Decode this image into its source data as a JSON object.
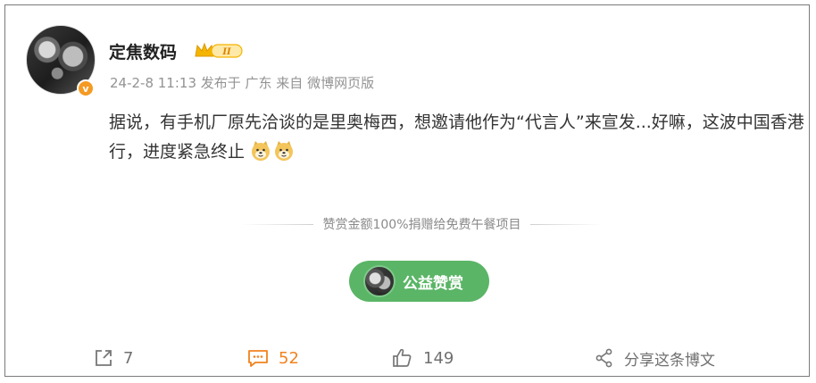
{
  "post": {
    "author": "定焦数码",
    "vip_level": "II",
    "verified_badge": "v",
    "meta": "24-2-8 11:13  发布于 广东  来自 微博网页版",
    "text": "据说，有手机厂原先洽谈的是里奥梅西，想邀请他作为“代言人”来宣发...好嘛，这波中国香港行，进度紧急终止"
  },
  "reward": {
    "caption": "赞赏金额100%捐赠给免费午餐项目",
    "button_label": "公益赞赏"
  },
  "actions": {
    "repost_count": "7",
    "comment_count": "52",
    "like_count": "149",
    "share_label": "分享这条博文"
  },
  "colors": {
    "reward_green": "#5ab566",
    "comment_orange": "#f0821e",
    "vip_gold": "#f5b400",
    "verified_orange": "#f59a23"
  }
}
